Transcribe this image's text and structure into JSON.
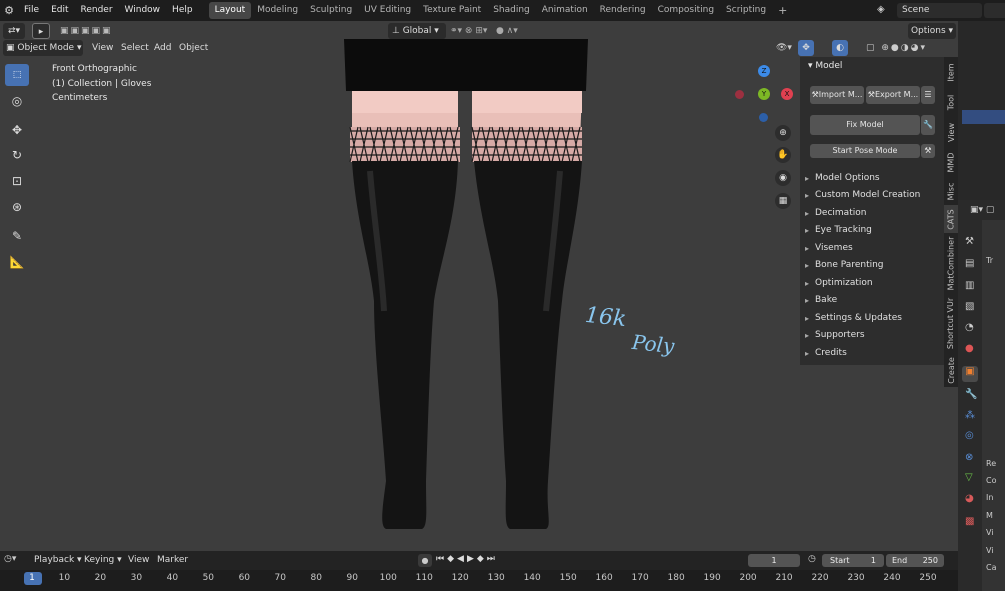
{
  "topbar": {
    "menus": [
      "File",
      "Edit",
      "Render",
      "Window",
      "Help"
    ],
    "workspaces": [
      "Layout",
      "Modeling",
      "Sculpting",
      "UV Editing",
      "Texture Paint",
      "Shading",
      "Animation",
      "Rendering",
      "Compositing",
      "Scripting"
    ],
    "active_workspace": "Layout",
    "add_tab": "+",
    "scene": "Scene"
  },
  "viewport_header": {
    "mode": "Object Mode",
    "menus": [
      "View",
      "Select",
      "Add",
      "Object"
    ],
    "transform_orientation": "Global",
    "options": "Options"
  },
  "viewport": {
    "view_name": "Front Orthographic",
    "collection": "(1) Collection | Gloves",
    "units": "Centimeters",
    "annotation_line1": "16k",
    "annotation_line2": "Poly",
    "axes": {
      "z": "Z",
      "y": "Y",
      "x": "X"
    }
  },
  "npanel": {
    "title": "Model",
    "import_label": "Import M...",
    "export_label": "Export M...",
    "fix_model": "Fix Model",
    "start_pose": "Start Pose Mode",
    "sections": [
      "Model Options",
      "Custom Model Creation",
      "Decimation",
      "Eye Tracking",
      "Visemes",
      "Bone Parenting",
      "Optimization",
      "Bake",
      "Settings & Updates",
      "Supporters",
      "Credits"
    ]
  },
  "vtabs": [
    "Item",
    "Tool",
    "View",
    "MMD",
    "Misc",
    "CATS",
    "MatCombiner",
    "Shortcut VUr",
    "Create"
  ],
  "active_vtab": "CATS",
  "props_rows": [
    "Re",
    "Co",
    "In",
    "M",
    "Vi",
    "Vi",
    "Ca"
  ],
  "props_header_letter": "Tr",
  "timeline": {
    "menus": [
      "Playback",
      "Keying",
      "View",
      "Marker"
    ],
    "current_frame": "1",
    "start_label": "Start",
    "start": "1",
    "end_label": "End",
    "end": "250",
    "ruler": [
      "1",
      "10",
      "20",
      "30",
      "40",
      "50",
      "60",
      "70",
      "80",
      "90",
      "100",
      "110",
      "120",
      "130",
      "140",
      "150",
      "160",
      "170",
      "180",
      "190",
      "200",
      "210",
      "220",
      "230",
      "240",
      "250"
    ]
  },
  "colors": {
    "accent": "#4772b3",
    "x_axis": "#e04050",
    "y_axis": "#7db825",
    "z_axis": "#3c8be8",
    "annotation": "#8ac6ee"
  }
}
